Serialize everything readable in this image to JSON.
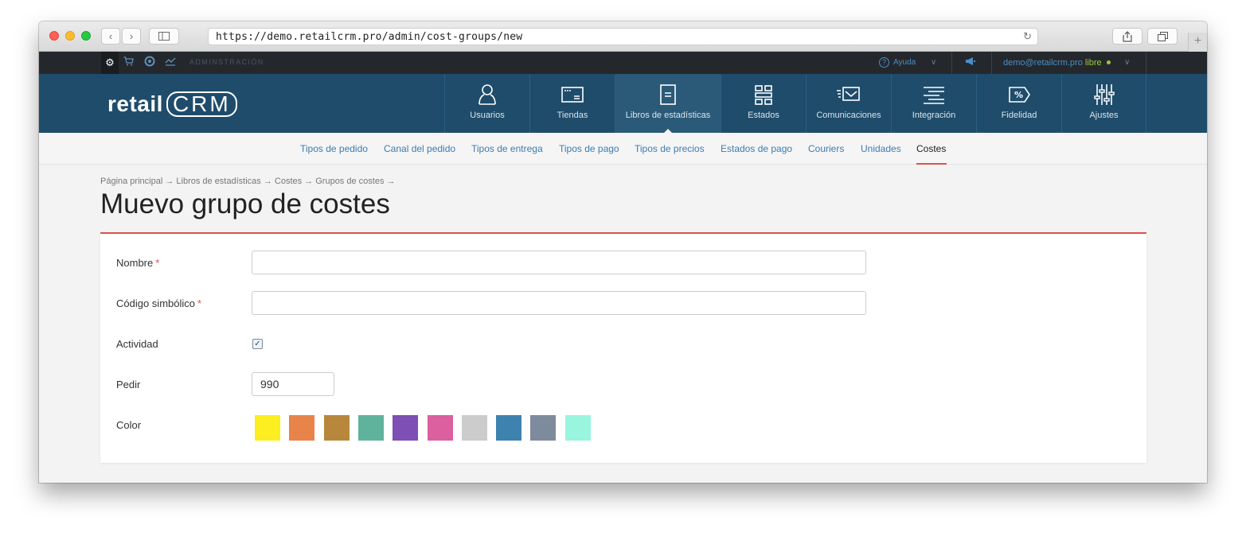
{
  "browser": {
    "url": "https://demo.retailcrm.pro/admin/cost-groups/new"
  },
  "admin_bar": {
    "section_label": "ADMINSTRACIÓN",
    "help_label": "Ayuda",
    "user_email": "demo@retailcrm.pro",
    "user_plan": "libre"
  },
  "logo": {
    "left": "retail",
    "right": "CRM"
  },
  "main_nav": {
    "items": [
      {
        "label": "Usuarios",
        "icon": "user-icon"
      },
      {
        "label": "Tiendas",
        "icon": "window-icon"
      },
      {
        "label": "Libros de estadísticas",
        "icon": "document-icon",
        "active": true
      },
      {
        "label": "Estados",
        "icon": "grid-icon"
      },
      {
        "label": "Comunicaciones",
        "icon": "mail-icon"
      },
      {
        "label": "Integración",
        "icon": "lines-icon"
      },
      {
        "label": "Fidelidad",
        "icon": "percent-tag-icon"
      },
      {
        "label": "Ajustes",
        "icon": "sliders-icon"
      }
    ]
  },
  "sub_nav": {
    "items": [
      {
        "label": "Tipos de pedido"
      },
      {
        "label": "Canal del pedido"
      },
      {
        "label": "Tipos de entrega"
      },
      {
        "label": "Tipos de pago"
      },
      {
        "label": "Tipos de precios"
      },
      {
        "label": "Estados de pago"
      },
      {
        "label": "Couriers"
      },
      {
        "label": "Unidades"
      },
      {
        "label": "Costes",
        "active": true
      }
    ]
  },
  "breadcrumb": "Página principal → Libros de estadísticas → Costes → Grupos de costes →",
  "page_title": "Muevo grupo de costes",
  "form": {
    "name_label": "Nombre",
    "name_value": "",
    "code_label": "Código simbólico",
    "code_value": "",
    "required_mark": "*",
    "activity_label": "Actividad",
    "activity_checked": true,
    "order_label": "Pedir",
    "order_value": "990",
    "color_label": "Color",
    "colors": [
      "#fcee21",
      "#e8834a",
      "#b8873c",
      "#5fb39d",
      "#7e4fb5",
      "#dc5fa0",
      "#cccccc",
      "#3e82b0",
      "#7e8b9c",
      "#99f5dd"
    ]
  },
  "accent_color": "#d9534f",
  "header_color": "#1f4c6b"
}
